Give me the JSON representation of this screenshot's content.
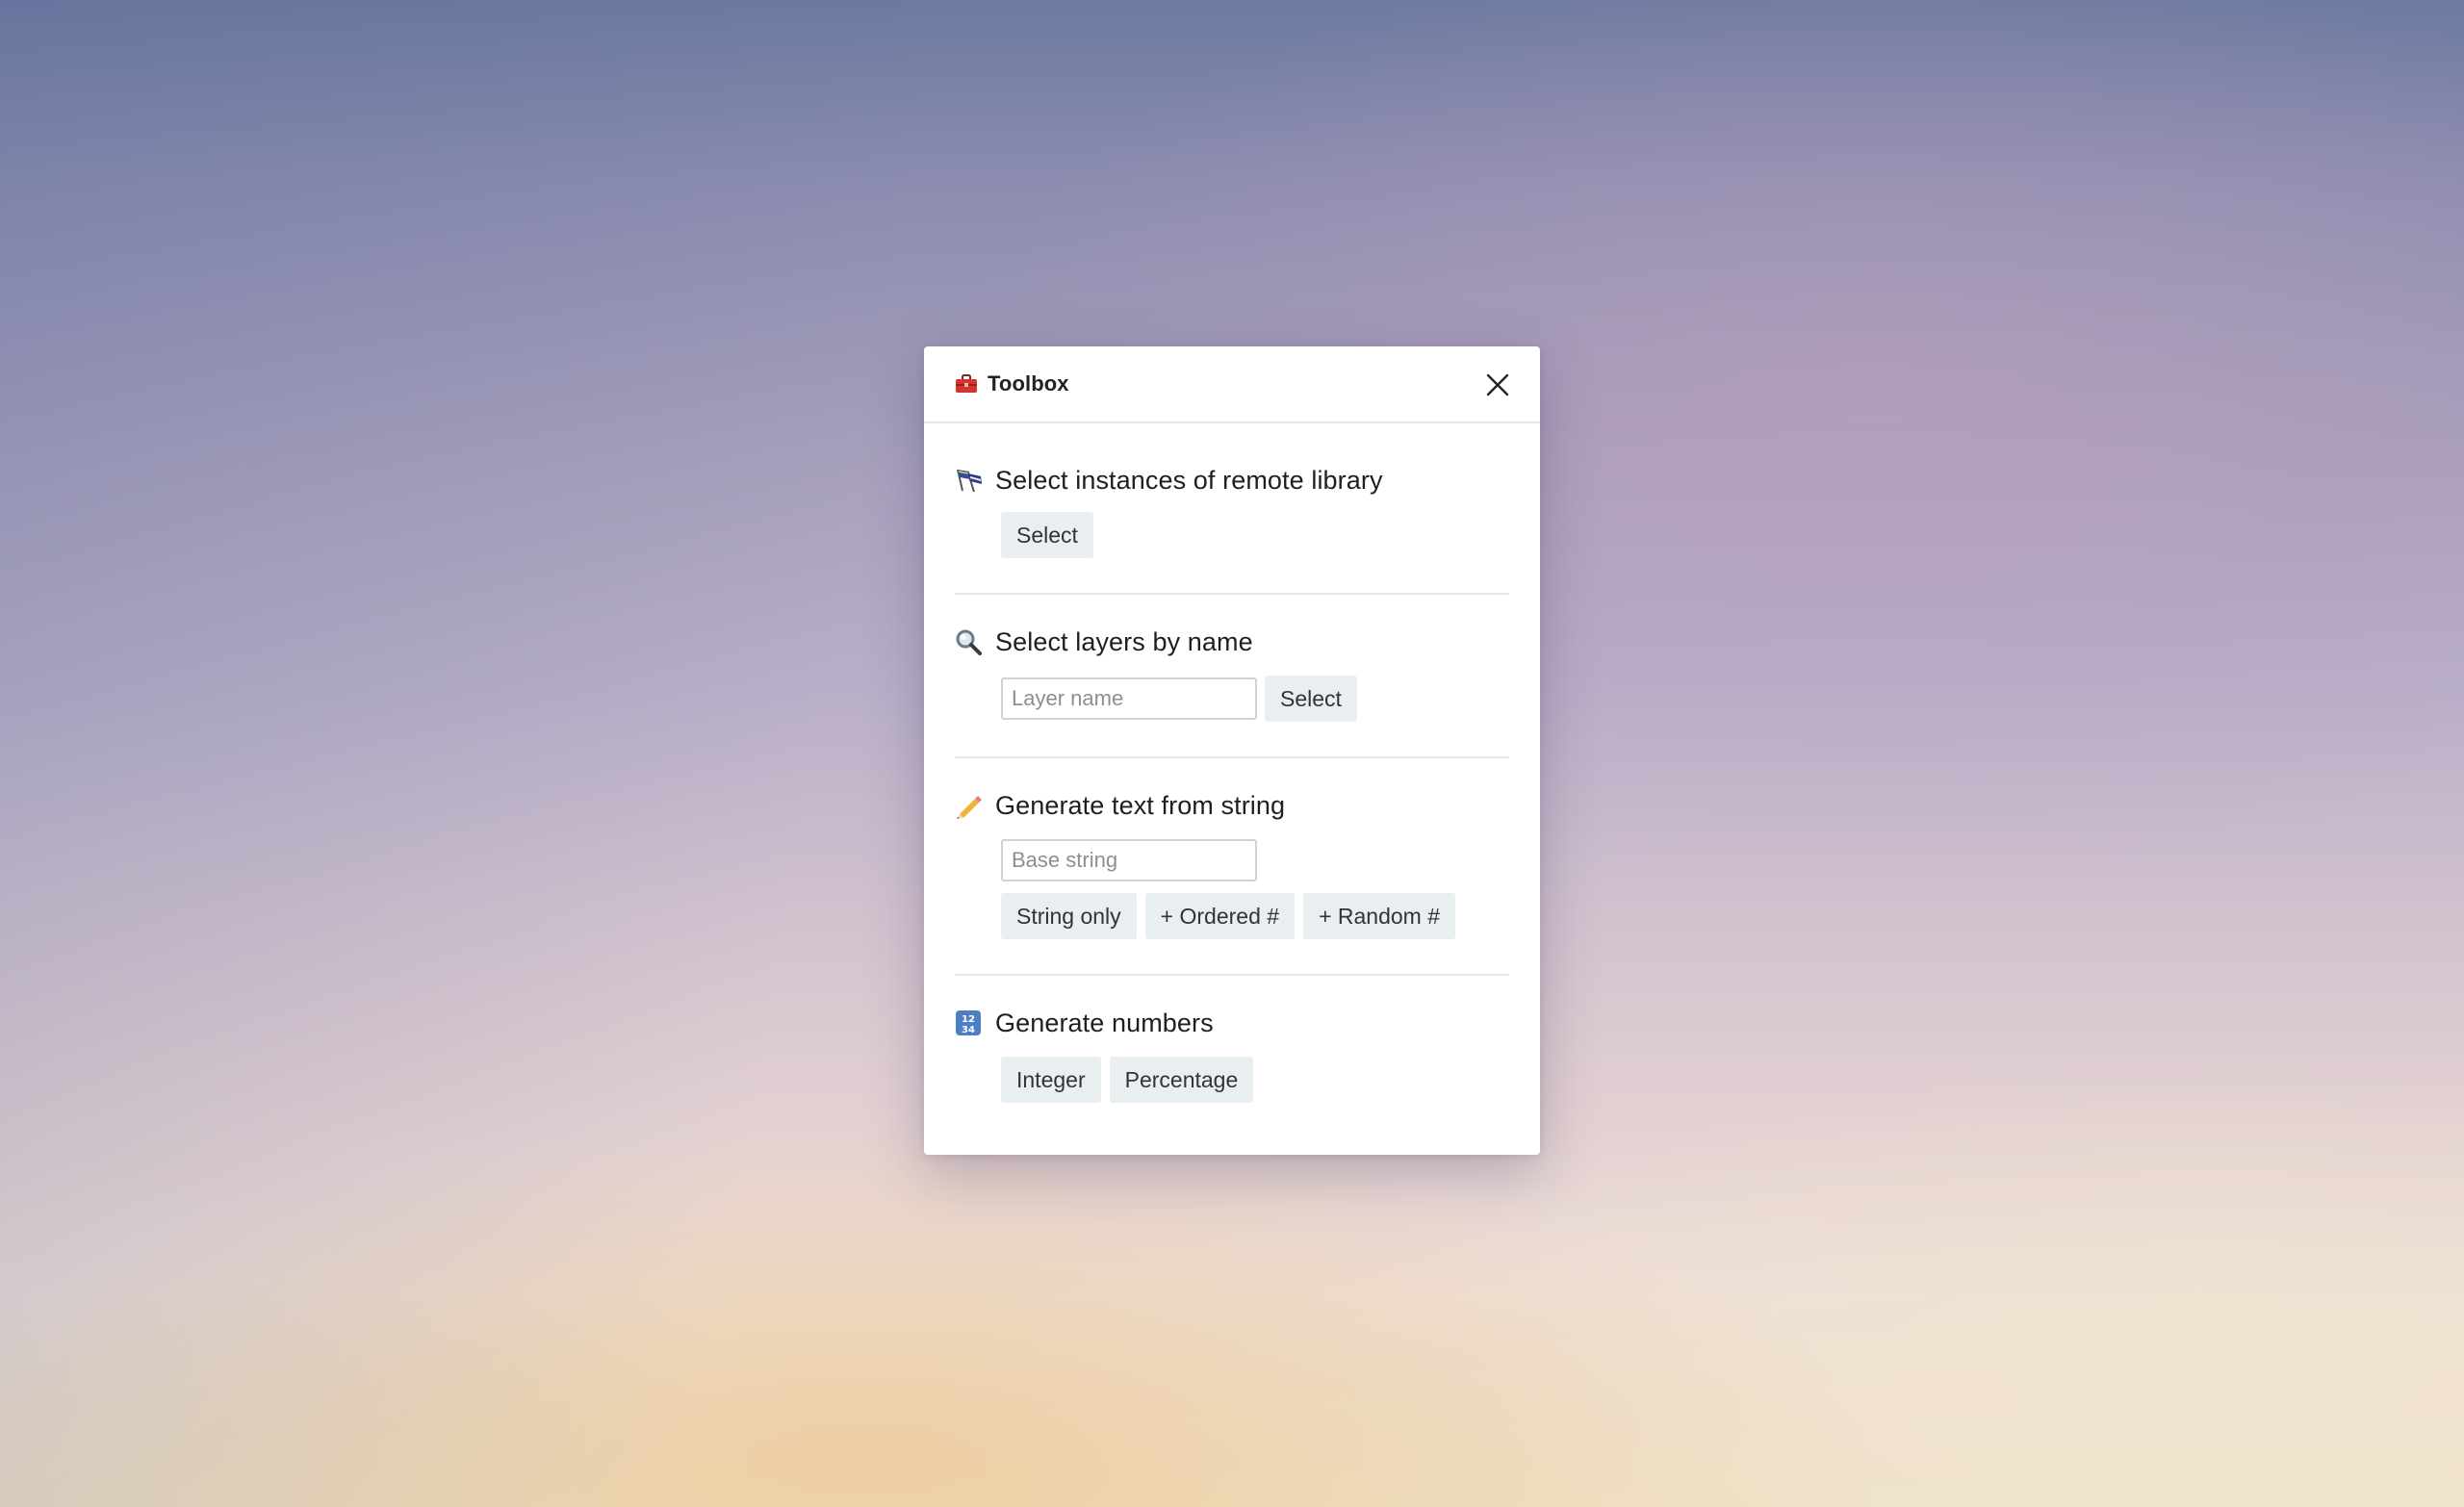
{
  "dialog": {
    "title": "Toolbox",
    "title_icon": "toolbox-icon",
    "close_icon": "close-icon"
  },
  "sections": [
    {
      "icon": "flags-icon",
      "title": "Select instances of remote library",
      "buttons": [
        "Select"
      ]
    },
    {
      "icon": "magnifier-icon",
      "title": "Select layers by name",
      "input_placeholder": "Layer name",
      "buttons": [
        "Select"
      ]
    },
    {
      "icon": "pencil-icon",
      "title": "Generate text from string",
      "input_placeholder": "Base string",
      "buttons": [
        "String only",
        "+ Ordered #",
        "+ Random #"
      ]
    },
    {
      "icon": "numbers-icon",
      "title": "Generate numbers",
      "buttons": [
        "Integer",
        "Percentage"
      ]
    }
  ],
  "colors": {
    "button_bg": "#e9eef0",
    "divider": "#e6e6e6",
    "toolbox_red": "#d6332f"
  }
}
